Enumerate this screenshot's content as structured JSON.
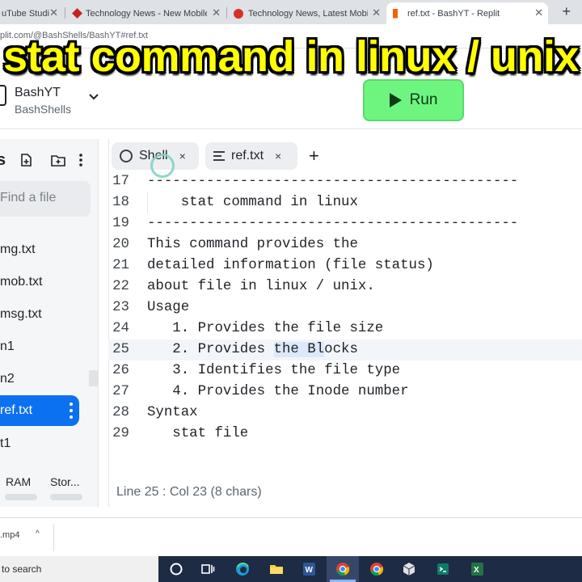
{
  "browser": {
    "tabs": [
      {
        "title": "uTube Studi"
      },
      {
        "title": "Technology News - New Mobile"
      },
      {
        "title": "Technology News, Latest Mobile"
      },
      {
        "title": "ref.txt - BashYT - Replit"
      }
    ],
    "new_tab": "+",
    "url": "plit.com/@BashShells/BashYT#ref.txt"
  },
  "overlay_caption": "stat command in linux / unix",
  "header": {
    "repl_name": "BashYT",
    "repl_owner": "BashShells",
    "run_label": "Run"
  },
  "sidebar": {
    "title": "s",
    "find_placeholder": "Find a file",
    "files": [
      {
        "name": "mg.txt"
      },
      {
        "name": "mob.txt"
      },
      {
        "name": "msg.txt"
      },
      {
        "name": "n1"
      },
      {
        "name": "n2"
      },
      {
        "name": "ref.txt",
        "active": true
      },
      {
        "name": "t1"
      }
    ],
    "resources": [
      {
        "label": "RAM"
      },
      {
        "label": "Stor..."
      }
    ]
  },
  "editor": {
    "tabs": [
      {
        "label": "Shell",
        "close": "×"
      },
      {
        "label": "ref.txt",
        "close": "×"
      }
    ],
    "add_tab": "+",
    "lines": [
      {
        "n": "17",
        "text": "--------------------------------------------"
      },
      {
        "n": "18",
        "text": "    stat command in linux"
      },
      {
        "n": "19",
        "text": "--------------------------------------------"
      },
      {
        "n": "20",
        "text": "This command provides the"
      },
      {
        "n": "21",
        "text": "detailed information (file status)"
      },
      {
        "n": "22",
        "text": "about file in linux / unix."
      },
      {
        "n": "23",
        "text": "Usage"
      },
      {
        "n": "24",
        "text": "   1. Provides the file size"
      },
      {
        "n": "25",
        "text": "   2. Provides ",
        "sel": "the Bl",
        "after": "ocks",
        "current": true
      },
      {
        "n": "26",
        "text": "   3. Identifies the file type"
      },
      {
        "n": "27",
        "text": "   4. Provides the Inode number"
      },
      {
        "n": "28",
        "text": "Syntax"
      },
      {
        "n": "29",
        "text": "   stat file"
      }
    ],
    "status": "Line 25 : Col 23 (8 chars)"
  },
  "downloads": {
    "file": ".mp4",
    "chevron": "^"
  },
  "taskbar": {
    "search_text": "to search"
  },
  "colors": {
    "run_green": "#6ef580",
    "active_file_blue": "#0b71f0",
    "caption_yellow": "#ffff00"
  }
}
